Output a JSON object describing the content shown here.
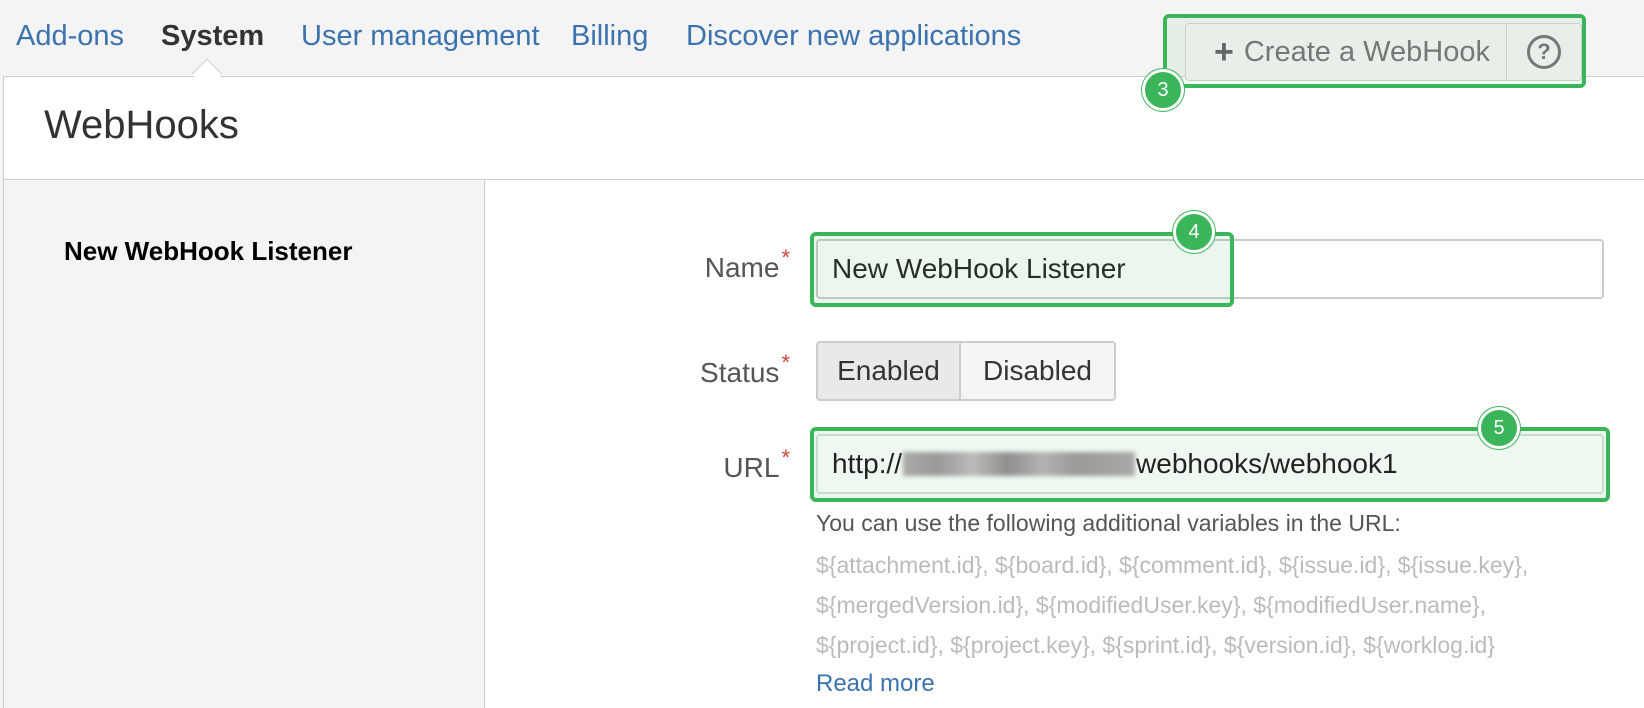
{
  "nav": {
    "tabs": [
      {
        "label": "Add-ons",
        "active": false
      },
      {
        "label": "System",
        "active": true
      },
      {
        "label": "User management",
        "active": false
      },
      {
        "label": "Billing",
        "active": false
      },
      {
        "label": "Discover new applications",
        "active": false
      }
    ]
  },
  "header": {
    "title": "WebHooks",
    "create_button": "Create a WebHook",
    "help_icon": "question-circle-icon"
  },
  "sidebar": {
    "title": "New WebHook Listener"
  },
  "form": {
    "name_label": "Name",
    "name_value": "New WebHook Listener",
    "status_label": "Status",
    "status_options": [
      "Enabled",
      "Disabled"
    ],
    "status_selected": "Enabled",
    "url_label": "URL",
    "url_prefix": "http://",
    "url_suffix": "webhooks/webhook1",
    "required_marker": "*",
    "help_text": "You can use the following additional variables in the URL:",
    "variables_lines": [
      "${attachment.id}, ${board.id}, ${comment.id}, ${issue.id}, ${issue.key},",
      "${mergedVersion.id}, ${modifiedUser.key}, ${modifiedUser.name},",
      "${project.id}, ${project.key}, ${sprint.id}, ${version.id}, ${worklog.id}"
    ],
    "read_more": "Read more"
  },
  "annotations": {
    "badge_create": "3",
    "badge_name": "4",
    "badge_url": "5",
    "highlight_color": "#3bb55a"
  },
  "colors": {
    "link": "#3b73af",
    "required": "#d04437"
  }
}
